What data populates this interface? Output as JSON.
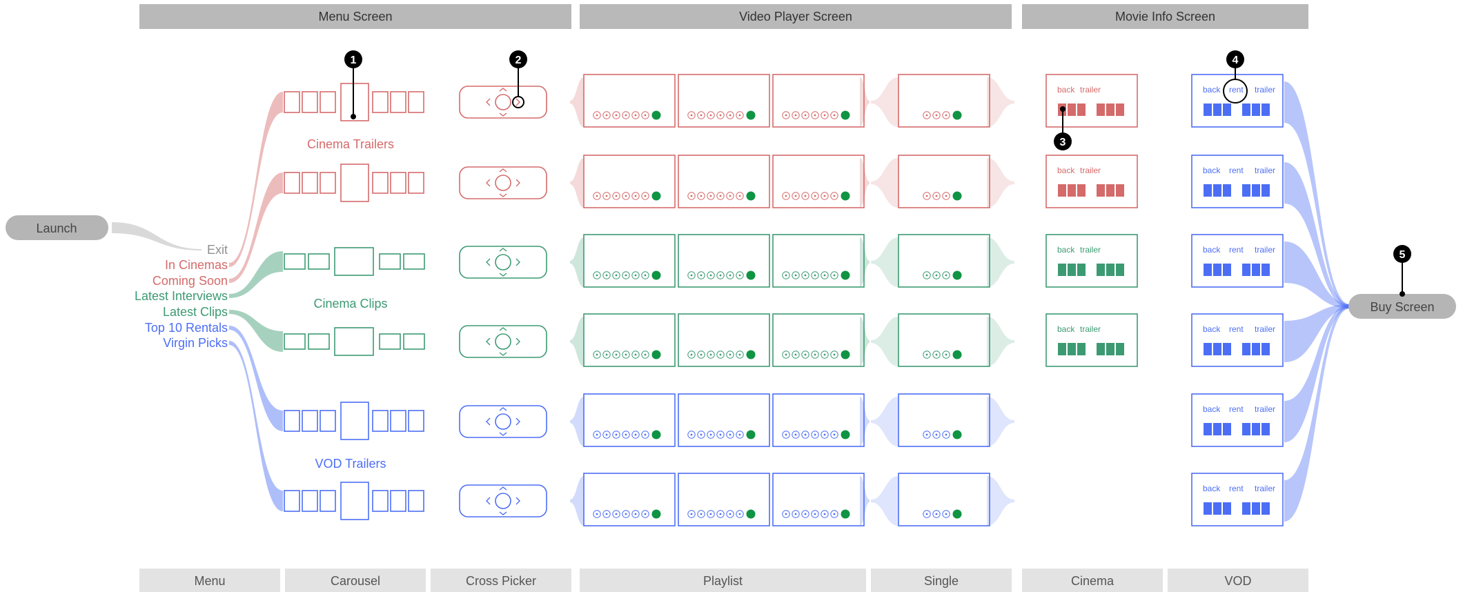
{
  "colors": {
    "red": "#d56a6a",
    "green": "#3c9a72",
    "blue": "#4c6ef5",
    "gray": "#8f8f8f",
    "indicator": "#0f9443",
    "header_bg": "#b9b9b9",
    "footer_bg": "#e3e3e3",
    "pill_bg": "#b5b5b5"
  },
  "headers": {
    "menu": "Menu Screen",
    "video": "Video Player Screen",
    "movie_info": "Movie Info Screen"
  },
  "footers": {
    "menu": "Menu",
    "carousel": "Carousel",
    "cross_picker": "Cross Picker",
    "playlist": "Playlist",
    "single": "Single",
    "cinema": "Cinema",
    "vod": "VOD"
  },
  "launch": "Launch",
  "buy_screen": "Buy Screen",
  "menu_items": [
    {
      "label": "Exit",
      "color": "gray"
    },
    {
      "label": "In Cinemas",
      "color": "red"
    },
    {
      "label": "Coming Soon",
      "color": "red"
    },
    {
      "label": "Latest Interviews",
      "color": "green"
    },
    {
      "label": "Latest Clips",
      "color": "green"
    },
    {
      "label": "Top 10 Rentals",
      "color": "blue"
    },
    {
      "label": "Virgin Picks",
      "color": "blue"
    }
  ],
  "carousel_groups": [
    {
      "label": "Cinema Trailers",
      "color": "red"
    },
    {
      "label": "Cinema Clips",
      "color": "green"
    },
    {
      "label": "VOD Trailers",
      "color": "blue"
    }
  ],
  "rows": [
    {
      "color": "red",
      "cinema": true
    },
    {
      "color": "red",
      "cinema": true
    },
    {
      "color": "green",
      "cinema": true
    },
    {
      "color": "green",
      "cinema": true
    },
    {
      "color": "blue",
      "cinema": false
    },
    {
      "color": "blue",
      "cinema": false
    }
  ],
  "info_buttons": {
    "back": "back",
    "rent": "rent",
    "trailer": "trailer"
  },
  "callouts": [
    "1",
    "2",
    "3",
    "4",
    "5"
  ]
}
